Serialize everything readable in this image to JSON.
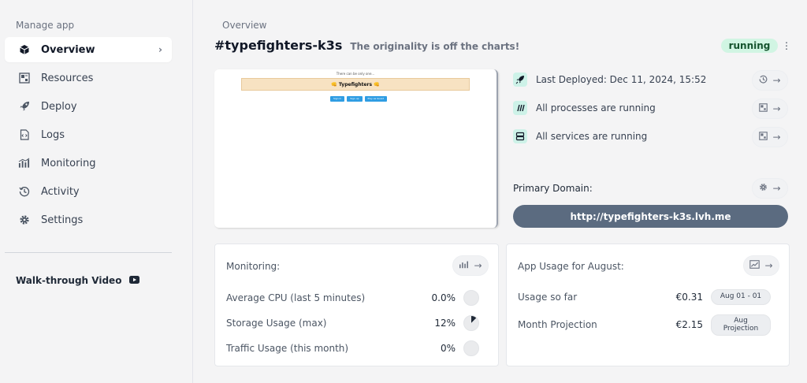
{
  "sidebar": {
    "heading": "Manage app",
    "items": [
      {
        "label": "Overview",
        "icon": "cube-icon"
      },
      {
        "label": "Resources",
        "icon": "resources-icon"
      },
      {
        "label": "Deploy",
        "icon": "rocket-icon"
      },
      {
        "label": "Logs",
        "icon": "logs-icon"
      },
      {
        "label": "Monitoring",
        "icon": "bar-chart-icon"
      },
      {
        "label": "Activity",
        "icon": "history-icon"
      },
      {
        "label": "Settings",
        "icon": "gear-icon"
      }
    ],
    "walkthrough_label": "Walk-through Video"
  },
  "header": {
    "breadcrumb": "Overview",
    "app_name": "#typefighters-k3s",
    "tagline": "The originality is off the charts!",
    "status": "running",
    "status_color": "#d1f5e3"
  },
  "preview": {
    "top_text": "There can be only one...",
    "banner": "👊 Typefighters 👊",
    "buttons": [
      "Sign in",
      "Sign up",
      "Play as Guest"
    ]
  },
  "info": {
    "last_deployed": "Last Deployed: Dec 11, 2024, 15:52",
    "processes": "All processes are running",
    "services": "All services are running",
    "primary_domain_label": "Primary Domain:",
    "domain_url": "http://typefighters-k3s.lvh.me"
  },
  "monitoring": {
    "title": "Monitoring:",
    "rows": [
      {
        "label": "Average CPU (last 5 minutes)",
        "value": "0.0%",
        "fraction": 0
      },
      {
        "label": "Storage Usage (max)",
        "value": "12%",
        "fraction": 0.12
      },
      {
        "label": "Traffic Usage (this month)",
        "value": "0%",
        "fraction": 0
      }
    ]
  },
  "usage": {
    "title": "App Usage for August:",
    "rows": [
      {
        "label": "Usage so far",
        "value": "€0.31",
        "badge": "Aug 01 - 01"
      },
      {
        "label": "Month Projection",
        "value": "€2.15",
        "badge": "Aug Projection"
      }
    ]
  },
  "colors": {
    "accent": "#5b6b80",
    "teal_icon_bg": "#cdf2e8"
  }
}
